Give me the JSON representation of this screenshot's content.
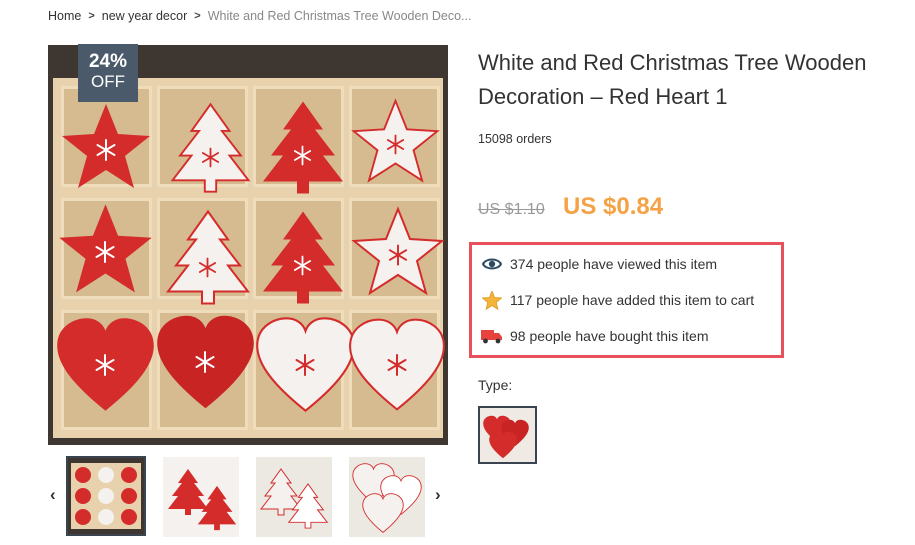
{
  "breadcrumb": {
    "home": "Home",
    "category": "new year decor",
    "current": "White and Red Christmas Tree Wooden Deco..."
  },
  "product": {
    "title": "White and Red Christmas Tree Wooden Decoration – Red Heart 1",
    "orders": "15098 orders",
    "old_price": "US $1.10",
    "new_price": "US $0.84",
    "discount": {
      "percent": "24%",
      "label": "OFF"
    }
  },
  "stats": {
    "viewed": "374 people have viewed this item",
    "added_to_cart": "117 people have added this item to cart",
    "bought": "98 people have bought this item"
  },
  "type": {
    "label": "Type:"
  },
  "thumbnails": {
    "prev_icon": "‹",
    "next_icon": "›"
  },
  "colors": {
    "price_accent": "#f5a246",
    "highlight_border": "#e8505b",
    "badge_bg": "#4a5a6a",
    "ornament_red": "#d42b2b"
  },
  "icons": [
    "eye-icon",
    "star-icon",
    "truck-icon",
    "chevron-right-icon",
    "chevron-left-icon"
  ]
}
